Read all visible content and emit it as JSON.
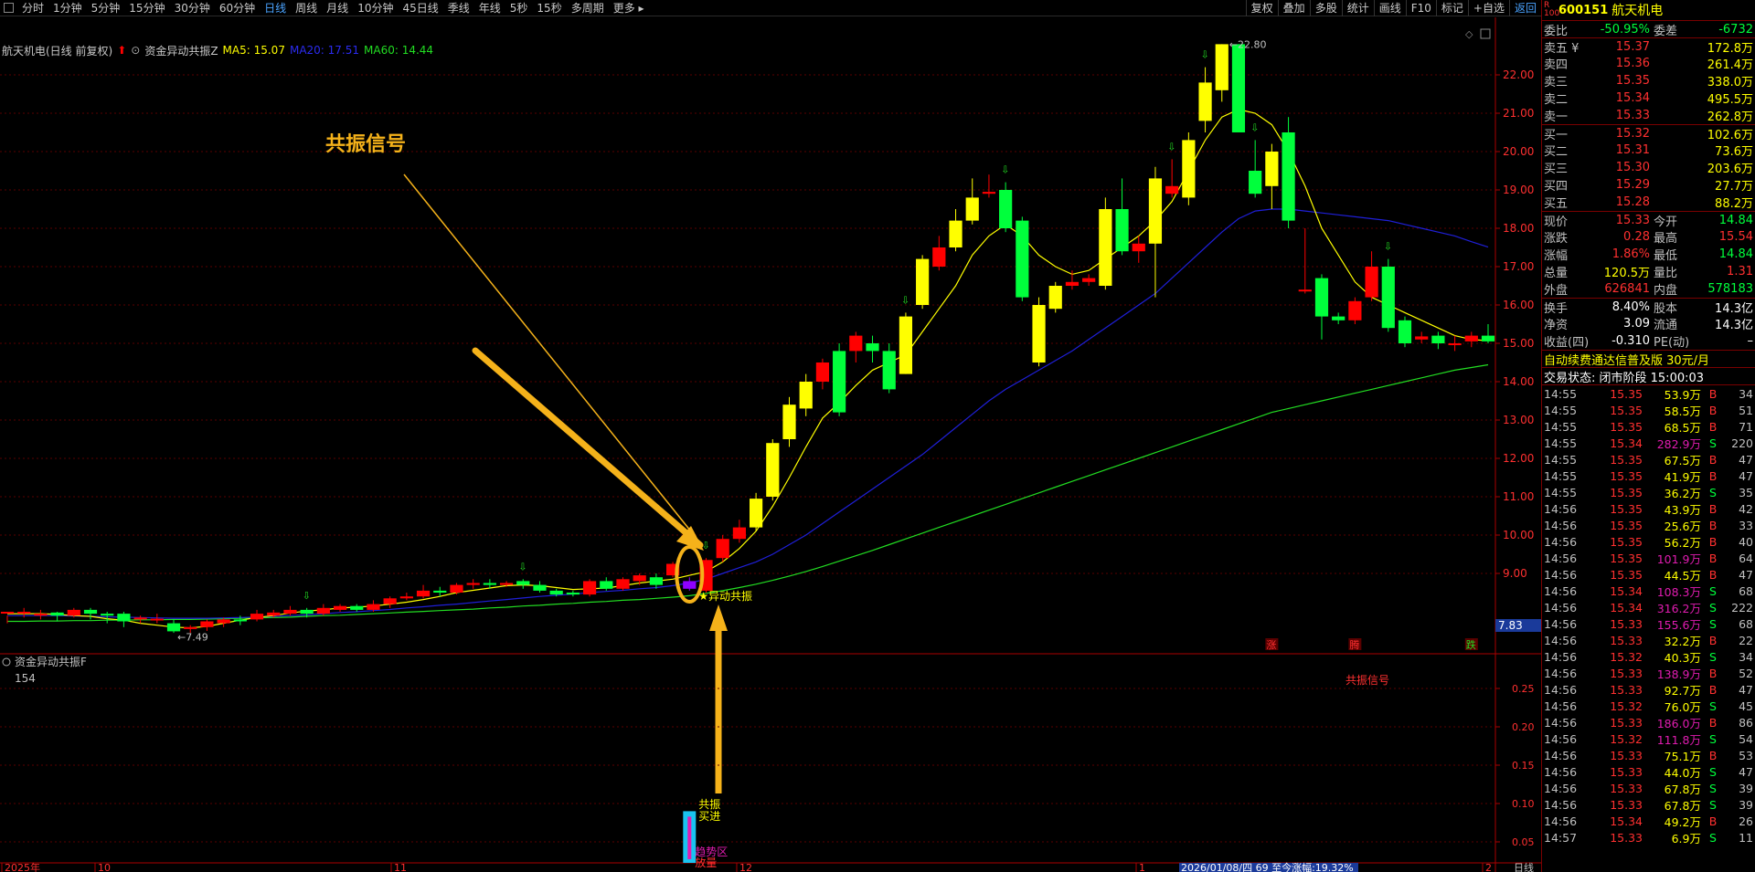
{
  "toolbar": {
    "periods": [
      "分时",
      "1分钟",
      "5分钟",
      "15分钟",
      "30分钟",
      "60分钟",
      "日线",
      "周线",
      "月线",
      "10分钟",
      "45日线",
      "季线",
      "年线",
      "5秒",
      "15秒",
      "多周期",
      "更多 ▸"
    ],
    "active_period": "日线",
    "tools": [
      "复权",
      "叠加",
      "多股",
      "统计",
      "画线",
      "F10",
      "标记",
      "+自选",
      "返回"
    ]
  },
  "stock": {
    "code": "600151",
    "name": "航天机电",
    "badge_r": "R",
    "badge_num": "100"
  },
  "infobar": {
    "title": "航天机电(日线 前复权)",
    "indicator": "资金异动共振Z",
    "ma5": "MA5: 15.07",
    "ma20": "MA20: 17.51",
    "ma60": "MA60: 14.44"
  },
  "colors": {
    "up": "#ff0000",
    "down": "#00ff3c",
    "yellow": "#ffff00",
    "purple": "#8f00ff",
    "ma5": "#ffff00",
    "ma20": "#1f1fd8",
    "ma60": "#22dd22",
    "axis": "#7a0000",
    "text_red": "#ff3030",
    "text_green": "#00ff3c",
    "accent_blue": "#4aa3ff"
  },
  "chart_data": {
    "type": "candlestick",
    "price_axis_labels": [
      "22.00",
      "21.00",
      "20.00",
      "19.00",
      "18.00",
      "17.00",
      "16.00",
      "15.00",
      "14.00",
      "13.00",
      "12.00",
      "11.00",
      "10.00",
      "9.00"
    ],
    "ylim": [
      7.0,
      23.0
    ],
    "current_price_label": "7.83",
    "high_label": "22.80",
    "low_label": "7.49",
    "candles": [
      [
        8.0,
        8.0,
        7.9,
        7.7
      ],
      [
        8.0,
        8.0,
        8.1,
        7.85
      ],
      [
        7.9,
        7.95,
        8.05,
        7.8
      ],
      [
        7.98,
        7.9,
        8.0,
        7.75
      ],
      [
        7.9,
        8.05,
        8.1,
        7.85
      ],
      [
        8.05,
        7.95,
        8.1,
        7.8
      ],
      [
        7.95,
        7.9,
        8.0,
        7.7
      ],
      [
        7.95,
        7.75,
        8.0,
        7.6
      ],
      [
        7.8,
        7.85,
        7.9,
        7.7
      ],
      [
        7.8,
        7.82,
        7.95,
        7.7
      ],
      [
        7.7,
        7.49,
        7.8,
        7.45
      ],
      [
        7.55,
        7.6,
        7.65,
        7.45
      ],
      [
        7.6,
        7.75,
        7.8,
        7.5
      ],
      [
        7.7,
        7.8,
        7.85,
        7.6
      ],
      [
        7.8,
        7.75,
        7.9,
        7.65
      ],
      [
        7.8,
        7.95,
        8.05,
        7.75
      ],
      [
        7.9,
        7.98,
        8.05,
        7.85
      ],
      [
        7.95,
        8.05,
        8.15,
        7.9
      ],
      [
        8.05,
        7.95,
        8.1,
        7.85
      ],
      [
        7.95,
        8.1,
        8.2,
        7.9
      ],
      [
        8.05,
        8.15,
        8.2,
        8.0
      ],
      [
        8.15,
        8.05,
        8.2,
        8.0
      ],
      [
        8.05,
        8.2,
        8.3,
        8.0
      ],
      [
        8.2,
        8.35,
        8.4,
        8.1
      ],
      [
        8.35,
        8.4,
        8.5,
        8.3
      ],
      [
        8.4,
        8.55,
        8.7,
        8.35
      ],
      [
        8.55,
        8.5,
        8.65,
        8.4
      ],
      [
        8.5,
        8.7,
        8.75,
        8.45
      ],
      [
        8.7,
        8.75,
        8.85,
        8.6
      ],
      [
        8.75,
        8.7,
        8.85,
        8.6
      ],
      [
        8.7,
        8.75,
        8.8,
        8.65
      ],
      [
        8.8,
        8.7,
        8.85,
        8.6
      ],
      [
        8.7,
        8.55,
        8.8,
        8.5
      ],
      [
        8.55,
        8.45,
        8.6,
        8.4
      ],
      [
        8.5,
        8.45,
        8.55,
        8.4
      ],
      [
        8.45,
        8.8,
        8.85,
        8.4
      ],
      [
        8.8,
        8.6,
        8.9,
        8.55
      ],
      [
        8.6,
        8.85,
        8.9,
        8.55
      ],
      [
        8.8,
        8.95,
        9.0,
        8.7
      ],
      [
        8.9,
        8.7,
        9.0,
        8.6
      ],
      [
        8.95,
        9.25,
        9.3,
        8.9
      ],
      [
        8.8,
        8.6,
        8.9,
        8.55
      ],
      [
        8.55,
        9.35,
        9.4,
        8.5
      ],
      [
        9.4,
        9.9,
        10.0,
        9.3
      ],
      [
        9.9,
        10.2,
        10.4,
        9.8
      ],
      [
        10.2,
        10.95,
        11.1,
        10.1
      ],
      [
        11.0,
        12.4,
        12.5,
        10.9
      ],
      [
        12.5,
        13.4,
        13.6,
        12.3
      ],
      [
        13.3,
        14.0,
        14.2,
        13.1
      ],
      [
        14.0,
        14.5,
        14.6,
        13.8
      ],
      [
        14.8,
        13.2,
        15.0,
        13.1
      ],
      [
        14.8,
        15.2,
        15.3,
        14.5
      ],
      [
        15.0,
        14.8,
        15.2,
        14.5
      ],
      [
        14.8,
        13.8,
        15.0,
        13.7
      ],
      [
        14.2,
        15.7,
        15.8,
        14.2
      ],
      [
        16.0,
        17.2,
        17.3,
        15.9
      ],
      [
        17.0,
        17.5,
        17.8,
        16.9
      ],
      [
        17.5,
        18.2,
        18.5,
        17.4
      ],
      [
        18.2,
        18.8,
        19.3,
        18.1
      ],
      [
        18.9,
        18.95,
        19.4,
        18.8
      ],
      [
        19.0,
        18.0,
        19.2,
        17.9
      ],
      [
        18.2,
        16.2,
        18.3,
        16.1
      ],
      [
        14.5,
        16.0,
        16.2,
        14.4
      ],
      [
        15.9,
        16.5,
        16.6,
        15.8
      ],
      [
        16.5,
        16.6,
        16.9,
        16.4
      ],
      [
        16.6,
        16.7,
        16.8,
        16.5
      ],
      [
        16.5,
        18.5,
        18.8,
        16.4
      ],
      [
        18.5,
        17.4,
        19.3,
        17.3
      ],
      [
        17.4,
        17.6,
        17.8,
        17.1
      ],
      [
        17.6,
        19.3,
        19.6,
        16.2
      ],
      [
        18.9,
        19.1,
        19.8,
        18.8
      ],
      [
        18.8,
        20.3,
        20.5,
        18.6
      ],
      [
        20.8,
        21.8,
        22.2,
        20.5
      ],
      [
        21.6,
        22.8,
        22.8,
        21.3
      ],
      [
        22.8,
        20.5,
        22.8,
        20.5
      ],
      [
        19.5,
        18.9,
        20.3,
        18.8
      ],
      [
        19.1,
        20.0,
        20.2,
        18.5
      ],
      [
        20.5,
        18.2,
        20.9,
        18.0
      ],
      [
        16.4,
        16.4,
        18.0,
        16.3
      ],
      [
        16.7,
        15.7,
        16.8,
        15.1
      ],
      [
        15.7,
        15.6,
        15.8,
        15.5
      ],
      [
        15.6,
        16.1,
        16.2,
        15.5
      ],
      [
        16.2,
        17.0,
        17.4,
        16.1
      ],
      [
        17.0,
        15.4,
        17.2,
        15.3
      ],
      [
        15.6,
        15.0,
        15.7,
        14.9
      ],
      [
        15.1,
        15.18,
        15.3,
        15.0
      ],
      [
        15.2,
        15.0,
        15.3,
        14.85
      ],
      [
        15.0,
        15.0,
        15.2,
        14.8
      ],
      [
        15.05,
        15.2,
        15.3,
        14.9
      ],
      [
        15.2,
        15.05,
        15.5,
        15.0
      ]
    ],
    "special_candle_index": 41,
    "markers_text": {
      "signal_label": "异动共振",
      "bottom_tags": [
        "涨",
        "腾",
        "跌"
      ]
    },
    "ma5": [
      7.95,
      7.95,
      7.95,
      7.93,
      7.9,
      7.88,
      7.82,
      7.78,
      7.7,
      7.65,
      7.6,
      7.58,
      7.62,
      7.7,
      7.78,
      7.85,
      7.9,
      7.97,
      8.02,
      8.05,
      8.1,
      8.12,
      8.15,
      8.2,
      8.25,
      8.32,
      8.4,
      8.5,
      8.56,
      8.62,
      8.68,
      8.7,
      8.68,
      8.63,
      8.58,
      8.6,
      8.62,
      8.68,
      8.75,
      8.8,
      8.85,
      8.95,
      9.05,
      9.3,
      9.65,
      10.1,
      10.75,
      11.5,
      12.3,
      13.05,
      13.45,
      13.9,
      14.3,
      14.5,
      14.7,
      15.3,
      15.9,
      16.5,
      17.3,
      17.8,
      18.1,
      17.8,
      17.3,
      17.0,
      16.8,
      16.9,
      17.2,
      17.5,
      17.8,
      18.2,
      18.7,
      19.5,
      20.3,
      20.9,
      21.1,
      21.0,
      20.7,
      20.0,
      19.1,
      18.0,
      17.3,
      16.6,
      16.2,
      16.0,
      15.8,
      15.6,
      15.4,
      15.2,
      15.1,
      15.07
    ],
    "ma20": [
      7.9,
      7.9,
      7.9,
      7.9,
      7.89,
      7.88,
      7.87,
      7.86,
      7.85,
      7.84,
      7.83,
      7.83,
      7.83,
      7.84,
      7.85,
      7.86,
      7.88,
      7.9,
      7.92,
      7.95,
      7.98,
      8.0,
      8.03,
      8.06,
      8.1,
      8.13,
      8.17,
      8.2,
      8.24,
      8.28,
      8.32,
      8.36,
      8.4,
      8.43,
      8.46,
      8.5,
      8.53,
      8.56,
      8.6,
      8.63,
      8.68,
      8.75,
      8.85,
      9.0,
      9.15,
      9.3,
      9.5,
      9.75,
      10.0,
      10.3,
      10.6,
      10.9,
      11.2,
      11.5,
      11.8,
      12.1,
      12.45,
      12.8,
      13.15,
      13.5,
      13.8,
      14.05,
      14.3,
      14.55,
      14.8,
      15.1,
      15.4,
      15.7,
      16.0,
      16.3,
      16.7,
      17.1,
      17.5,
      17.9,
      18.25,
      18.45,
      18.5,
      18.5,
      18.45,
      18.4,
      18.35,
      18.3,
      18.25,
      18.2,
      18.1,
      18.0,
      17.9,
      17.8,
      17.65,
      17.51
    ],
    "ma60": [
      7.75,
      7.75,
      7.76,
      7.76,
      7.77,
      7.77,
      7.78,
      7.78,
      7.79,
      7.79,
      7.8,
      7.8,
      7.81,
      7.82,
      7.83,
      7.84,
      7.85,
      7.86,
      7.88,
      7.9,
      7.91,
      7.93,
      7.95,
      7.97,
      7.99,
      8.01,
      8.03,
      8.05,
      8.07,
      8.1,
      8.12,
      8.15,
      8.17,
      8.2,
      8.22,
      8.25,
      8.27,
      8.3,
      8.32,
      8.35,
      8.38,
      8.42,
      8.48,
      8.55,
      8.63,
      8.72,
      8.82,
      8.93,
      9.05,
      9.18,
      9.32,
      9.46,
      9.6,
      9.75,
      9.9,
      10.05,
      10.2,
      10.35,
      10.5,
      10.65,
      10.8,
      10.95,
      11.1,
      11.25,
      11.4,
      11.55,
      11.7,
      11.85,
      12.0,
      12.15,
      12.3,
      12.45,
      12.6,
      12.75,
      12.9,
      13.05,
      13.2,
      13.3,
      13.4,
      13.5,
      13.6,
      13.7,
      13.8,
      13.9,
      14.0,
      14.1,
      14.2,
      14.3,
      14.37,
      14.44
    ]
  },
  "annotation": {
    "text": "共振信号"
  },
  "sub": {
    "title": "资金异动共振F",
    "value": "154",
    "signal_text": "共振信号",
    "axis_labels": [
      "0.25",
      "0.20",
      "0.15",
      "0.10",
      "0.05"
    ],
    "bar_value": 0.09,
    "bar_texts": [
      "共振",
      "买进",
      "趋势区",
      "放量"
    ]
  },
  "xaxis": {
    "labels": [
      "2025年",
      "10",
      "11",
      "12",
      "1",
      "2"
    ],
    "status": "2026/01/08/四 69 至今涨幅:19.32%",
    "period_label": "日线"
  },
  "quote": {
    "ratio_label": "委比",
    "ratio": "-50.95%",
    "diff_label": "委差",
    "diff": "-6732",
    "asks": [
      {
        "l": "卖五 ¥",
        "p": "15.37",
        "v": "172.8万"
      },
      {
        "l": "卖四",
        "p": "15.36",
        "v": "261.4万"
      },
      {
        "l": "卖三",
        "p": "15.35",
        "v": "338.0万"
      },
      {
        "l": "卖二",
        "p": "15.34",
        "v": "495.5万"
      },
      {
        "l": "卖一",
        "p": "15.33",
        "v": "262.8万"
      }
    ],
    "bids": [
      {
        "l": "买一",
        "p": "15.32",
        "v": "102.6万"
      },
      {
        "l": "买二",
        "p": "15.31",
        "v": "73.6万"
      },
      {
        "l": "买三",
        "p": "15.30",
        "v": "203.6万"
      },
      {
        "l": "买四",
        "p": "15.29",
        "v": "27.7万"
      },
      {
        "l": "买五",
        "p": "15.28",
        "v": "88.2万"
      }
    ],
    "stats": [
      {
        "l1": "现价",
        "v1": "15.33",
        "c1": "#ff3030",
        "l2": "今开",
        "v2": "14.84",
        "c2": "#00ff3c"
      },
      {
        "l1": "涨跌",
        "v1": "0.28",
        "c1": "#ff3030",
        "l2": "最高",
        "v2": "15.54",
        "c2": "#ff3030"
      },
      {
        "l1": "涨幅",
        "v1": "1.86%",
        "c1": "#ff3030",
        "l2": "最低",
        "v2": "14.84",
        "c2": "#00ff3c"
      },
      {
        "l1": "总量",
        "v1": "120.5万",
        "c1": "#ffff00",
        "l2": "量比",
        "v2": "1.31",
        "c2": "#ff3030"
      },
      {
        "l1": "外盘",
        "v1": "626841",
        "c1": "#ff3030",
        "l2": "内盘",
        "v2": "578183",
        "c2": "#00ff3c"
      }
    ],
    "stats2": [
      {
        "l1": "换手",
        "v1": "8.40%",
        "l2": "股本",
        "v2": "14.3亿"
      },
      {
        "l1": "净资",
        "v1": "3.09",
        "l2": "流通",
        "v2": "14.3亿"
      },
      {
        "l1": "收益(四)",
        "v1": "-0.310",
        "l2": "PE(动)",
        "v2": "–"
      }
    ],
    "promo": "自动续费通达信普及版 30元/月",
    "trade_status": "交易状态: 闭市阶段 15:00:03"
  },
  "ticks": [
    [
      "14:55",
      "15.35",
      "53.9万",
      "B",
      "34"
    ],
    [
      "14:55",
      "15.35",
      "58.5万",
      "B",
      "51"
    ],
    [
      "14:55",
      "15.35",
      "68.5万",
      "B",
      "71"
    ],
    [
      "14:55",
      "15.34",
      "282.9万",
      "S",
      "220"
    ],
    [
      "14:55",
      "15.35",
      "67.5万",
      "B",
      "47"
    ],
    [
      "14:55",
      "15.35",
      "41.9万",
      "B",
      "47"
    ],
    [
      "14:55",
      "15.35",
      "36.2万",
      "S",
      "35"
    ],
    [
      "14:56",
      "15.35",
      "43.9万",
      "B",
      "42"
    ],
    [
      "14:56",
      "15.35",
      "25.6万",
      "B",
      "33"
    ],
    [
      "14:56",
      "15.35",
      "56.2万",
      "B",
      "40"
    ],
    [
      "14:56",
      "15.35",
      "101.9万",
      "B",
      "64"
    ],
    [
      "14:56",
      "15.35",
      "44.5万",
      "B",
      "47"
    ],
    [
      "14:56",
      "15.34",
      "108.3万",
      "S",
      "68"
    ],
    [
      "14:56",
      "15.34",
      "316.2万",
      "S",
      "222"
    ],
    [
      "14:56",
      "15.33",
      "155.6万",
      "S",
      "68"
    ],
    [
      "14:56",
      "15.33",
      "32.2万",
      "B",
      "22"
    ],
    [
      "14:56",
      "15.32",
      "40.3万",
      "S",
      "34"
    ],
    [
      "14:56",
      "15.33",
      "138.9万",
      "B",
      "52"
    ],
    [
      "14:56",
      "15.33",
      "92.7万",
      "B",
      "47"
    ],
    [
      "14:56",
      "15.32",
      "76.0万",
      "S",
      "45"
    ],
    [
      "14:56",
      "15.33",
      "186.0万",
      "B",
      "86"
    ],
    [
      "14:56",
      "15.32",
      "111.8万",
      "S",
      "54"
    ],
    [
      "14:56",
      "15.33",
      "75.1万",
      "B",
      "53"
    ],
    [
      "14:56",
      "15.33",
      "44.0万",
      "S",
      "47"
    ],
    [
      "14:56",
      "15.33",
      "67.8万",
      "S",
      "39"
    ],
    [
      "14:56",
      "15.33",
      "67.8万",
      "S",
      "39"
    ],
    [
      "14:56",
      "15.34",
      "49.2万",
      "B",
      "26"
    ],
    [
      "14:57",
      "15.33",
      "6.9万",
      "S",
      "11"
    ]
  ]
}
